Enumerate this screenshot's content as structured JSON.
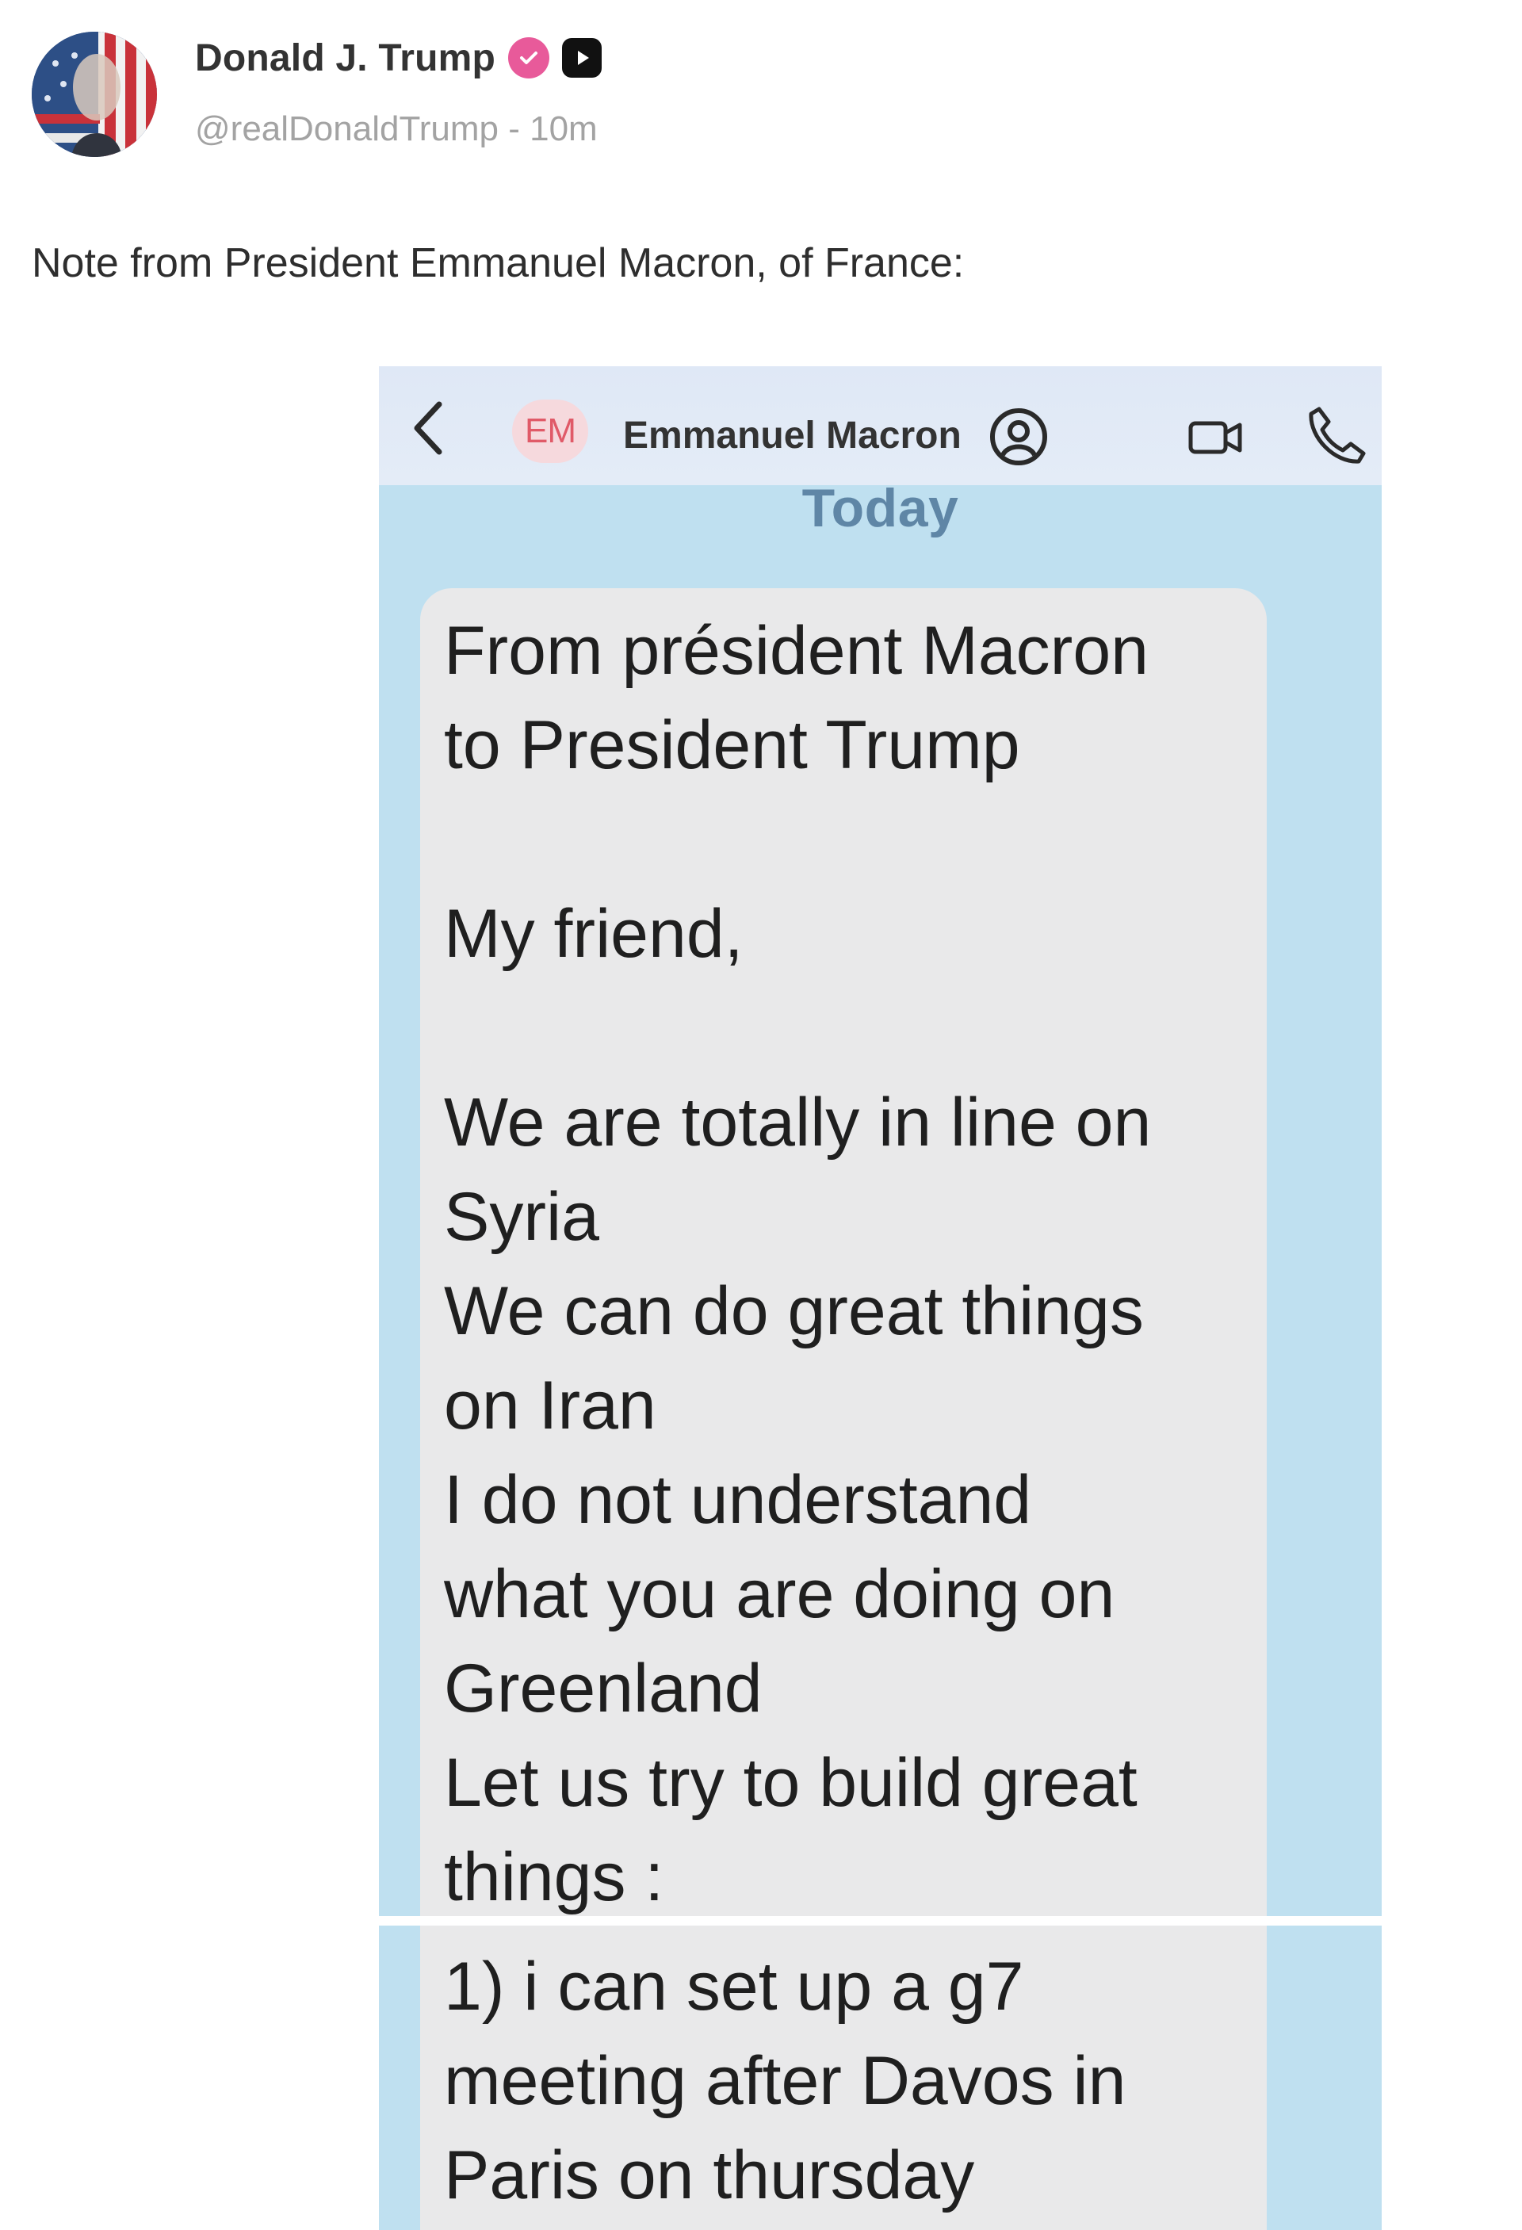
{
  "post": {
    "author_name": "Donald J. Trump",
    "handle": "@realDonaldTrump",
    "separator": "-",
    "time": "10m",
    "text": "Note from President Emmanuel Macron, of France:",
    "avatar_icon": "flag-portrait-avatar",
    "verified_icon": "verified-badge-icon",
    "media_icon": "media-play-icon"
  },
  "screenshot": {
    "contact_initials": "EM",
    "contact_name": "Emmanuel Macron",
    "date_label": "Today",
    "back_icon": "chevron-left-icon",
    "contact_icon": "contact-person-icon",
    "video_icon": "video-camera-icon",
    "call_icon": "phone-icon",
    "message_1": "From président Macron\nto President Trump\n\nMy friend,\n\nWe are totally in line on\nSyria\nWe can do great things\non Iran\nI do not understand\nwhat you are doing on\nGreenland\nLet us try to build great\nthings :",
    "message_2": "1) i can set up a g7\nmeeting after Davos in\nParis on thursday"
  },
  "colors": {
    "screenshot_background": "#bfe0f0",
    "bubble": "#e9e9ea",
    "today_label": "#5f86a6",
    "initials": "#e05a68",
    "verified_badge": "#e85a9a"
  }
}
